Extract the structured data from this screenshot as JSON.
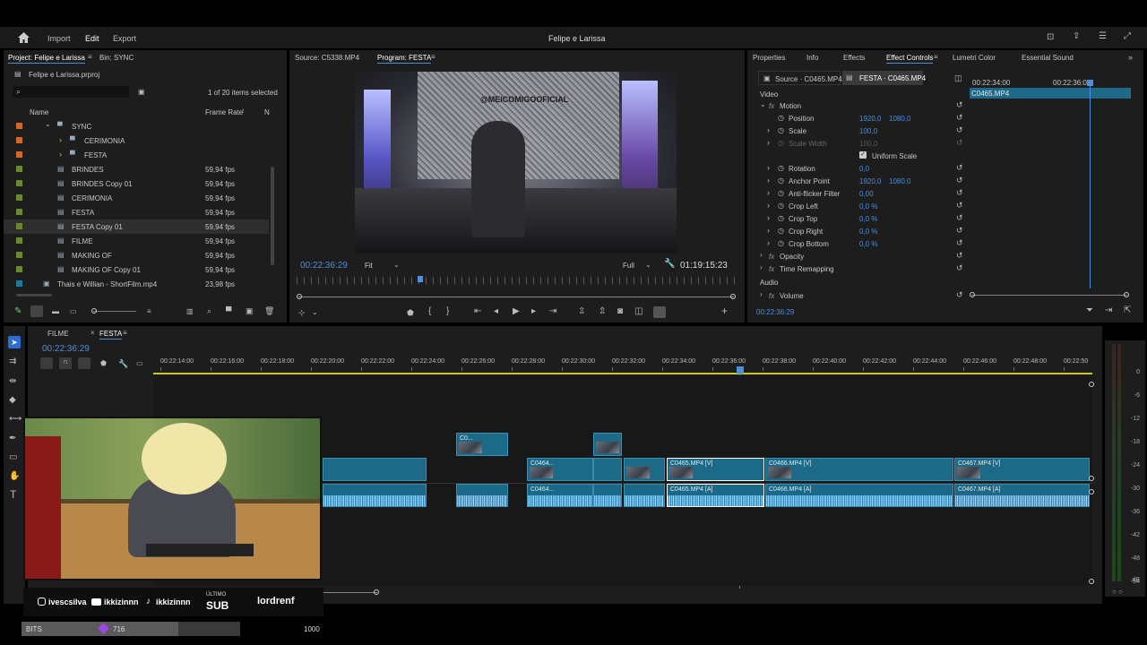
{
  "app": {
    "nav": {
      "import": "Import",
      "edit": "Edit",
      "export": "Export"
    },
    "title": "Felipe e Larissa"
  },
  "project": {
    "tab_project": "Project: Felipe e Larissa",
    "tab_bin": "Bin: SYNC",
    "file": "Felipe e Larissa.prproj",
    "selection": "1 of 20 items selected",
    "col_name": "Name",
    "col_rate": "Frame Rate",
    "items": [
      {
        "name": "SYNC",
        "rate": "",
        "color": "#d06a2a",
        "kind": "folder-open"
      },
      {
        "name": "CERIMONIA",
        "rate": "",
        "color": "#d06a2a",
        "kind": "folder"
      },
      {
        "name": "FESTA",
        "rate": "",
        "color": "#d06a2a",
        "kind": "folder"
      },
      {
        "name": "BRINDES",
        "rate": "59,94 fps",
        "color": "#6a8a2a",
        "kind": "seq"
      },
      {
        "name": "BRINDES Copy 01",
        "rate": "59,94 fps",
        "color": "#6a8a2a",
        "kind": "seq"
      },
      {
        "name": "CERIMONIA",
        "rate": "59,94 fps",
        "color": "#6a8a2a",
        "kind": "seq"
      },
      {
        "name": "FESTA",
        "rate": "59,94 fps",
        "color": "#6a8a2a",
        "kind": "seq"
      },
      {
        "name": "FESTA Copy 01",
        "rate": "59,94 fps",
        "color": "#6a8a2a",
        "kind": "seq"
      },
      {
        "name": "FILME",
        "rate": "59,94 fps",
        "color": "#6a8a2a",
        "kind": "seq"
      },
      {
        "name": "MAKING OF",
        "rate": "59,94 fps",
        "color": "#6a8a2a",
        "kind": "seq"
      },
      {
        "name": "MAKING OF Copy 01",
        "rate": "59,94 fps",
        "color": "#6a8a2a",
        "kind": "seq"
      },
      {
        "name": "Thais e Willian - ShortFilm.mp4",
        "rate": "23,98 fps",
        "color": "#1f7a9a",
        "kind": "clip"
      }
    ]
  },
  "monitor": {
    "tab_source": "Source: C5338.MP4",
    "tab_program": "Program: FESTA",
    "timecode": "00:22:36:29",
    "fit": "Fit",
    "quality": "Full",
    "duration": "01:19:15:23",
    "video_text": "@MEICOMIGOOFICIAL"
  },
  "effects": {
    "tabs": [
      "Properties",
      "Info",
      "Effects",
      "Effect Controls",
      "Lumetri Color",
      "Essential Sound"
    ],
    "source_tab": "Source · C0465.MP4",
    "seq_tab": "FESTA · C0465.MP4",
    "clip_name": "C0465.MP4",
    "ruler": [
      "00:22:34:00",
      "00:22:36:00"
    ],
    "section_video": "Video",
    "section_audio": "Audio",
    "props": [
      {
        "name": "Motion",
        "v1": "",
        "v2": "",
        "level": 0,
        "fx": true
      },
      {
        "name": "Position",
        "v1": "1920,0",
        "v2": "1080,0",
        "level": 1
      },
      {
        "name": "Scale",
        "v1": "100,0",
        "v2": "",
        "level": 1
      },
      {
        "name": "Scale Width",
        "v1": "100,0",
        "v2": "",
        "level": 1,
        "dim": true
      },
      {
        "name": "Uniform Scale",
        "v1": "",
        "v2": "",
        "level": 2,
        "checkbox": true
      },
      {
        "name": "Rotation",
        "v1": "0,0",
        "v2": "",
        "level": 1
      },
      {
        "name": "Anchor Point",
        "v1": "1920,0",
        "v2": "1080,0",
        "level": 1
      },
      {
        "name": "Anti-flicker Filter",
        "v1": "0,00",
        "v2": "",
        "level": 1
      },
      {
        "name": "Crop Left",
        "v1": "0,0 %",
        "v2": "",
        "level": 1
      },
      {
        "name": "Crop Top",
        "v1": "0,0 %",
        "v2": "",
        "level": 1
      },
      {
        "name": "Crop Right",
        "v1": "0,0 %",
        "v2": "",
        "level": 1
      },
      {
        "name": "Crop Bottom",
        "v1": "0,0 %",
        "v2": "",
        "level": 1
      },
      {
        "name": "Opacity",
        "v1": "",
        "v2": "",
        "level": 0,
        "fx": true
      },
      {
        "name": "Time Remapping",
        "v1": "",
        "v2": "",
        "level": 0,
        "fx": true
      }
    ],
    "volume": "Volume",
    "timecode": "00:22:36:29"
  },
  "timeline": {
    "tabs": [
      "FILME",
      "FESTA"
    ],
    "timecode": "00:22:36:29",
    "ruler": [
      "00:22:14:00",
      "00:22:16:00",
      "00:22:18:00",
      "00:22:20:00",
      "00:22:22:00",
      "00:22:24:00",
      "00:22:26:00",
      "00:22:28:00",
      "00:22:30:00",
      "00:22:32:00",
      "00:22:34:00",
      "00:22:36:00",
      "00:22:38:00",
      "00:22:40:00",
      "00:22:42:00",
      "00:22:44:00",
      "00:22:46:00",
      "00:22:48:00",
      "00:22:50"
    ],
    "clips": {
      "v2a": "C0...",
      "c0464v": "C0464...",
      "c0465v": "C0465.MP4 [V]",
      "c0466v": "C0466.MP4 [V]",
      "c0467v": "C0467.MP4 [V]",
      "c0464a": "C0464...",
      "c0465a": "C0465.MP4 [A]",
      "c0466a": "C0466.MP4 [A]",
      "c0467a": "C0467.MP4 [A]"
    },
    "meter_labels": [
      "0",
      "-6",
      "-12",
      "-18",
      "-24",
      "-30",
      "-36",
      "-42",
      "-48",
      "-54",
      "dB"
    ]
  },
  "overlay": {
    "handles": [
      {
        "platform": "instagram",
        "name": "ivescsilva"
      },
      {
        "platform": "youtube",
        "name": "ikkizinnn"
      },
      {
        "platform": "tiktok",
        "name": "ikkizinnn"
      }
    ],
    "sub_label": "ÚLTIMO",
    "sub": "SUB",
    "sub_name": "lordrenf",
    "bits_label": "BITS",
    "bits_value": "716",
    "bits_goal": "1000",
    "bits_progress": 0.716
  }
}
